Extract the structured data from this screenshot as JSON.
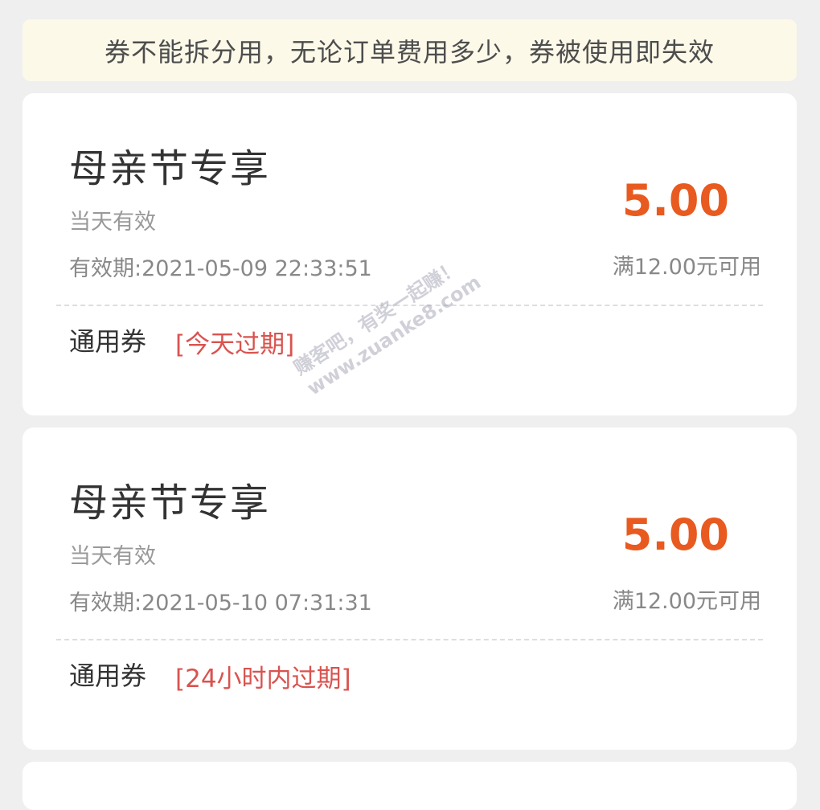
{
  "notice": {
    "text": "券不能拆分用，无论订单费用多少，券被使用即失效"
  },
  "coupons": [
    {
      "title": "母亲节专享",
      "subtitle": "当天有效",
      "validity": "有效期:2021-05-09 22:33:51",
      "amount": "5.00",
      "condition": "满12.00元可用",
      "type": "通用券",
      "expire_tag": "[今天过期]"
    },
    {
      "title": "母亲节专享",
      "subtitle": "当天有效",
      "validity": "有效期:2021-05-10 07:31:31",
      "amount": "5.00",
      "condition": "满12.00元可用",
      "type": "通用券",
      "expire_tag": "[24小时内过期]"
    }
  ],
  "watermark": {
    "line1": "赚客吧，有奖一起赚！",
    "line2": "www.zuanke8.com"
  },
  "colors": {
    "background": "#efefef",
    "notice_bg": "#fdf9e9",
    "amount": "#e85a1f",
    "expire_tag": "#d9534f"
  }
}
